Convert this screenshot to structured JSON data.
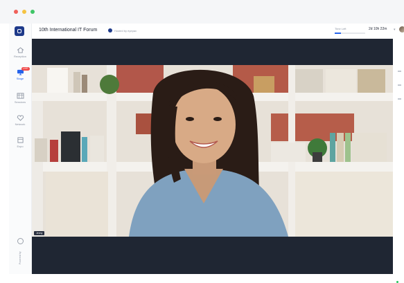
{
  "window": {
    "controls": [
      "close",
      "minimize",
      "maximize"
    ]
  },
  "sidebar": {
    "items": [
      {
        "label": "Reception",
        "icon": "home-icon",
        "active": false
      },
      {
        "label": "Stage",
        "icon": "presentation-icon",
        "active": true,
        "badge": "LIVE"
      },
      {
        "label": "Sessions",
        "icon": "grid-icon",
        "active": false
      },
      {
        "label": "Network",
        "icon": "heart-icon",
        "active": false
      },
      {
        "label": "Expo",
        "icon": "store-icon",
        "active": false
      }
    ],
    "powered_by": "Powered by"
  },
  "header": {
    "event_title": "10th International IT Forum",
    "host_label": "Hosted by eyepax",
    "time_label": "Time Left",
    "time_value": "2d 10h 22m",
    "time_progress": 0.2
  },
  "stage": {
    "speaker_name": "Jenny"
  },
  "colors": {
    "accent": "#2563eb",
    "stage_bg": "#1f2633",
    "live_badge": "#ef4444",
    "online": "#22c55e"
  }
}
